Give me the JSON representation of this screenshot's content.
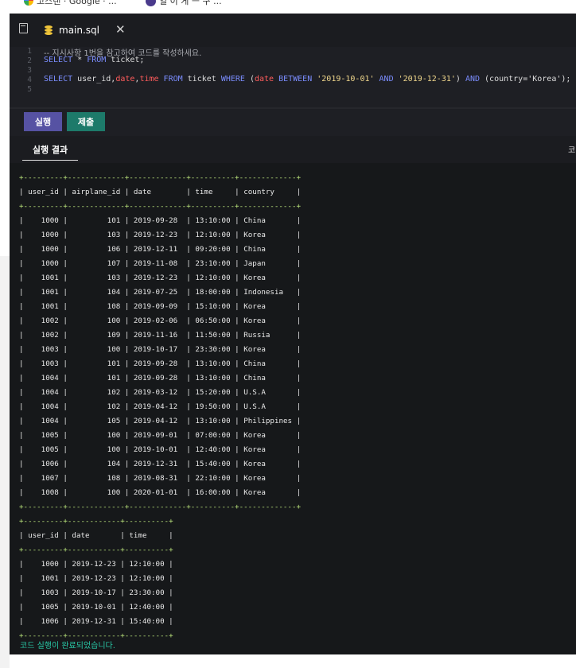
{
  "bookmarks": [
    {
      "icon": "google-icon",
      "label": "고스랜 · Google · ..."
    },
    {
      "icon": "purple-bookmark-icon",
      "label": "일 이 게 ㅡ 구 ..."
    }
  ],
  "tab": {
    "label": "main.sql",
    "icon": "database-icon"
  },
  "editor": {
    "line_numbers": [
      "1",
      "2",
      "3",
      "4",
      "5"
    ],
    "comment": "-- 지시사항 1번을 참고하여 코드를 작성하세요.",
    "line2": {
      "select": "SELECT",
      "star": " * ",
      "from": "FROM",
      "table": " ticket;"
    },
    "line4": {
      "select": "SELECT",
      "col_user_id": " user_id,",
      "col_date": "date",
      "comma1": ",",
      "col_time": "time",
      "from": " FROM",
      "table": " ticket",
      "where": " WHERE",
      "open": " (",
      "date2": "date",
      "between": " BETWEEN",
      "d1": " '2019-10-01'",
      "and1": " AND",
      "d2": " '2019-12-31'",
      "close": ")",
      "and2": " AND",
      "cond": " (country='Korea');"
    }
  },
  "buttons": {
    "run": "실행",
    "submit": "제출"
  },
  "results": {
    "tab_label": "실행 결과",
    "right_label": "코"
  },
  "table1": {
    "border": "+---------+-------------+-------------+----------+-------------+",
    "headers": [
      "user_id",
      "airplane_id",
      "date",
      "time",
      "country"
    ],
    "rows": [
      [
        "1000",
        "101",
        "2019-09-28",
        "13:10:00",
        "China"
      ],
      [
        "1000",
        "103",
        "2019-12-23",
        "12:10:00",
        "Korea"
      ],
      [
        "1000",
        "106",
        "2019-12-11",
        "09:20:00",
        "China"
      ],
      [
        "1000",
        "107",
        "2019-11-08",
        "23:10:00",
        "Japan"
      ],
      [
        "1001",
        "103",
        "2019-12-23",
        "12:10:00",
        "Korea"
      ],
      [
        "1001",
        "104",
        "2019-07-25",
        "18:00:00",
        "Indonesia"
      ],
      [
        "1001",
        "108",
        "2019-09-09",
        "15:10:00",
        "Korea"
      ],
      [
        "1002",
        "100",
        "2019-02-06",
        "06:50:00",
        "Korea"
      ],
      [
        "1002",
        "109",
        "2019-11-16",
        "11:50:00",
        "Russia"
      ],
      [
        "1003",
        "100",
        "2019-10-17",
        "23:30:00",
        "Korea"
      ],
      [
        "1003",
        "101",
        "2019-09-28",
        "13:10:00",
        "China"
      ],
      [
        "1004",
        "101",
        "2019-09-28",
        "13:10:00",
        "China"
      ],
      [
        "1004",
        "102",
        "2019-03-12",
        "15:20:00",
        "U.S.A"
      ],
      [
        "1004",
        "102",
        "2019-04-12",
        "19:50:00",
        "U.S.A"
      ],
      [
        "1004",
        "105",
        "2019-04-12",
        "13:10:00",
        "Philippines"
      ],
      [
        "1005",
        "100",
        "2019-09-01",
        "07:00:00",
        "Korea"
      ],
      [
        "1005",
        "100",
        "2019-10-01",
        "12:40:00",
        "Korea"
      ],
      [
        "1006",
        "104",
        "2019-12-31",
        "15:40:00",
        "Korea"
      ],
      [
        "1007",
        "108",
        "2019-08-31",
        "22:10:00",
        "Korea"
      ],
      [
        "1008",
        "100",
        "2020-01-01",
        "16:00:00",
        "Korea"
      ]
    ]
  },
  "table2": {
    "border": "+---------+------------+----------+",
    "headers": [
      "user_id",
      "date",
      "time"
    ],
    "rows": [
      [
        "1000",
        "2019-12-23",
        "12:10:00"
      ],
      [
        "1001",
        "2019-12-23",
        "12:10:00"
      ],
      [
        "1003",
        "2019-10-17",
        "23:30:00"
      ],
      [
        "1005",
        "2019-10-01",
        "12:40:00"
      ],
      [
        "1006",
        "2019-12-31",
        "15:40:00"
      ]
    ]
  },
  "status": "코드 실행이 완료되었습니다.",
  "colors": {
    "run_button": "#5652a3",
    "submit_button": "#1d7a6a",
    "status_text": "#28c7a6",
    "keyword": "#7b8dff",
    "field": "#ff5c5c",
    "string": "#f0d78c"
  }
}
